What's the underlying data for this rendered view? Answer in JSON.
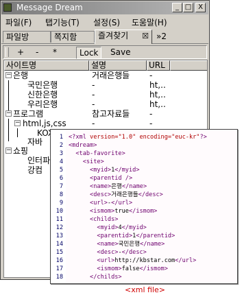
{
  "window": {
    "title": "Message Dream",
    "buttons": [
      "_",
      "□",
      "X"
    ]
  },
  "menu": [
    "파일(F)",
    "탭기능(T)",
    "설정(S)",
    "도움말(H)"
  ],
  "tabs": [
    {
      "label": "파일방",
      "active": false
    },
    {
      "label": "쪽지함",
      "active": false
    },
    {
      "label": "즐겨찾기",
      "active": true,
      "close": "☒"
    },
    {
      "label": "»2",
      "active": false
    }
  ],
  "toolbar": {
    "items": [
      "+",
      "-",
      "*",
      "Lock",
      "Save"
    ],
    "pressed": "Lock"
  },
  "grid": {
    "columns": [
      "사이트명",
      "설명",
      "URL"
    ],
    "rows": [
      {
        "name": "은행",
        "desc": "거래은행들",
        "url": "-",
        "level": 0,
        "toggle": "−"
      },
      {
        "name": "국민은행",
        "desc": "-",
        "url": "ht,..",
        "level": 1
      },
      {
        "name": "신한은행",
        "desc": "-",
        "url": "ht,..",
        "level": 1
      },
      {
        "name": "우리은행",
        "desc": "-",
        "url": "ht,..",
        "level": 1
      },
      {
        "name": "프로그램",
        "desc": "참고자료들",
        "url": "-",
        "level": 0,
        "toggle": "−"
      },
      {
        "name": "html,js,css",
        "desc": "-",
        "url": "-",
        "level": 1,
        "toggle": "−"
      },
      {
        "name": "KOX",
        "desc": "",
        "url": "",
        "level": 2
      },
      {
        "name": "자바",
        "desc": "",
        "url": "",
        "level": 1
      },
      {
        "name": "쇼핑",
        "desc": "",
        "url": "",
        "level": 0,
        "toggle": "−"
      },
      {
        "name": "인터파",
        "desc": "",
        "url": "",
        "level": 1
      },
      {
        "name": "강컴",
        "desc": "",
        "url": "",
        "level": 1
      }
    ]
  },
  "code": {
    "lines": [
      [
        [
          "tag",
          "<?xml "
        ],
        [
          "attr",
          "version="
        ],
        [
          "str",
          "\"1.0\" "
        ],
        [
          "attr",
          "encoding="
        ],
        [
          "str",
          "\"euc-kr\""
        ],
        [
          "tag",
          "?>"
        ]
      ],
      [
        [
          "tag",
          "<mdream>"
        ]
      ],
      [
        [
          "tag",
          "  <tab-favorite>"
        ]
      ],
      [
        [
          "tag",
          "    <site>"
        ]
      ],
      [
        [
          "tag",
          "      <myid>"
        ],
        [
          "txt",
          "1"
        ],
        [
          "tag",
          "</myid>"
        ]
      ],
      [
        [
          "tag",
          "      <parentid />"
        ]
      ],
      [
        [
          "tag",
          "      <name>"
        ],
        [
          "txt",
          "은행"
        ],
        [
          "tag",
          "</name>"
        ]
      ],
      [
        [
          "tag",
          "      <desc>"
        ],
        [
          "txt",
          "거래은행들"
        ],
        [
          "tag",
          "</desc>"
        ]
      ],
      [
        [
          "tag",
          "      <url>"
        ],
        [
          "txt",
          "-"
        ],
        [
          "tag",
          "</url>"
        ]
      ],
      [
        [
          "tag",
          "      <ismom>"
        ],
        [
          "txt",
          "true"
        ],
        [
          "tag",
          "</ismom>"
        ]
      ],
      [
        [
          "tag",
          "      <childs>"
        ]
      ],
      [
        [
          "tag",
          "        <myid>"
        ],
        [
          "txt",
          "4"
        ],
        [
          "tag",
          "</myid>"
        ]
      ],
      [
        [
          "tag",
          "        <parentid>"
        ],
        [
          "txt",
          "1"
        ],
        [
          "tag",
          "</parentid>"
        ]
      ],
      [
        [
          "tag",
          "        <name>"
        ],
        [
          "txt",
          "국민은행"
        ],
        [
          "tag",
          "</name>"
        ]
      ],
      [
        [
          "tag",
          "        <desc>"
        ],
        [
          "txt",
          "-"
        ],
        [
          "tag",
          "</desc>"
        ]
      ],
      [
        [
          "tag",
          "        <url>"
        ],
        [
          "txt",
          "http://kbstar.com"
        ],
        [
          "tag",
          "</url>"
        ]
      ],
      [
        [
          "tag",
          "        <ismom>"
        ],
        [
          "txt",
          "false"
        ],
        [
          "tag",
          "</ismom>"
        ]
      ],
      [
        [
          "tag",
          "      </childs>"
        ]
      ]
    ]
  },
  "caption": "<xml file>"
}
